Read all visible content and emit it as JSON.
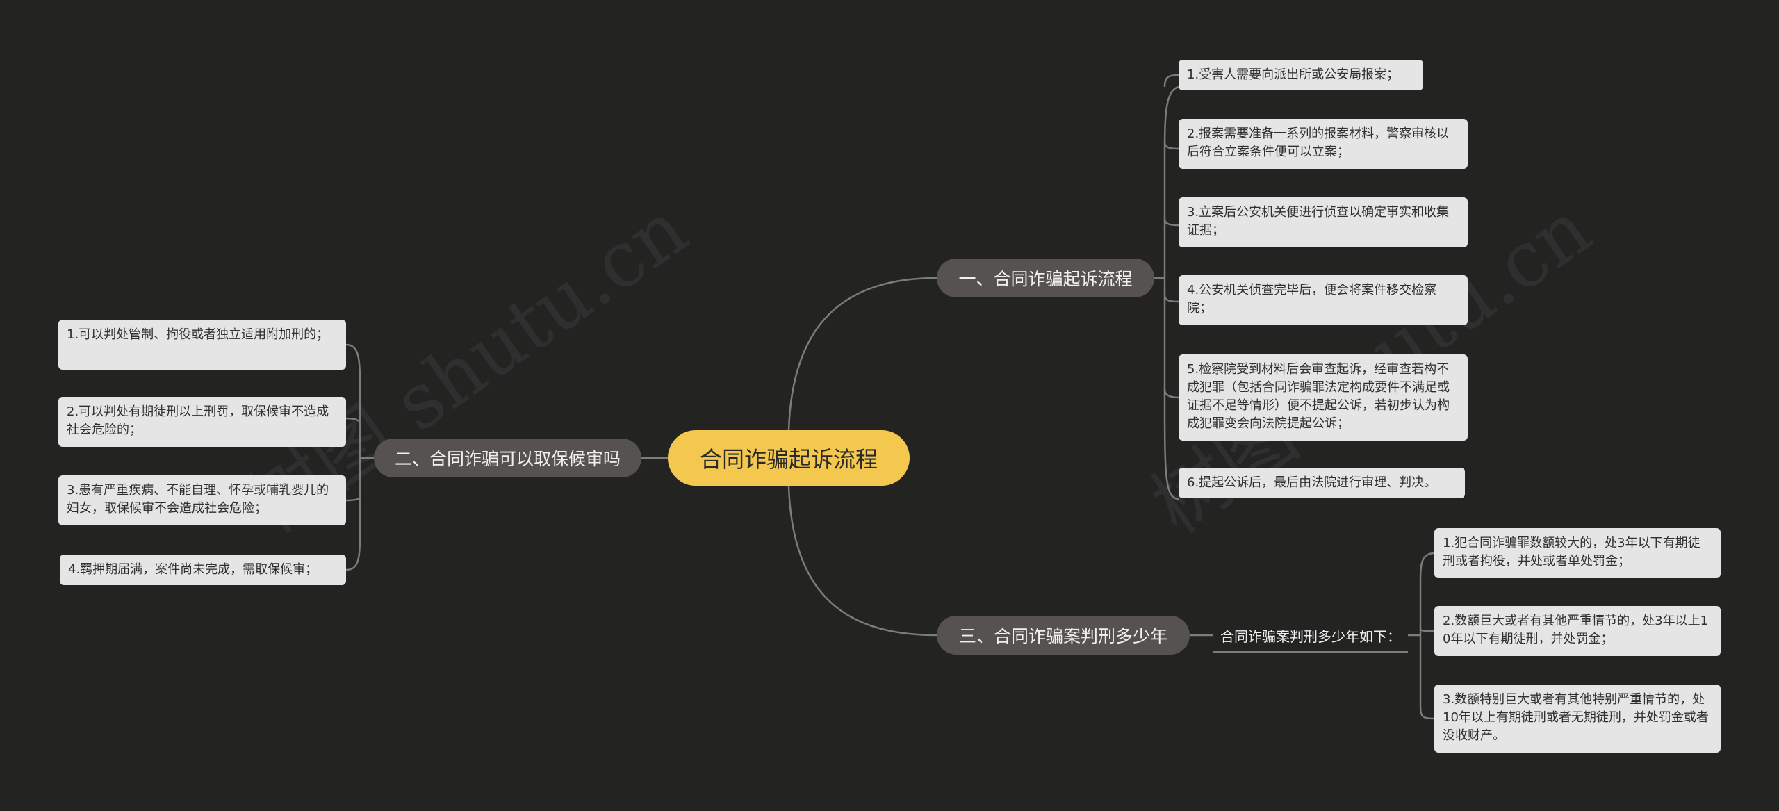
{
  "root": {
    "label": "合同诈骗起诉流程"
  },
  "watermark": "树图 shutu.cn",
  "branches": [
    {
      "label": "一、合同诈骗起诉流程",
      "items": [
        "1.受害人需要向派出所或公安局报案；",
        "2.报案需要准备一系列的报案材料，警察审核以后符合立案条件便可以立案；",
        "3.立案后公安机关便进行侦查以确定事实和收集证据；",
        "4.公安机关侦查完毕后，便会将案件移交检察院；",
        "5.检察院受到材料后会审查起诉，经审查若构不成犯罪（包括合同诈骗罪法定构成要件不满足或证据不足等情形）便不提起公诉，若初步认为构成犯罪变会向法院提起公诉；",
        "6.提起公诉后，最后由法院进行审理、判决。"
      ]
    },
    {
      "label": "二、合同诈骗可以取保候审吗",
      "items": [
        "1.可以判处管制、拘役或者独立适用附加刑的；",
        "2.可以判处有期徒刑以上刑罚，取保候审不造成社会危险的；",
        "3.患有严重疾病、不能自理、怀孕或哺乳婴儿的妇女，取保候审不会造成社会危险；",
        "4.羁押期届满，案件尚未完成，需取保候审；"
      ]
    },
    {
      "label": "三、合同诈骗案判刑多少年",
      "sub_label": "合同诈骗案判刑多少年如下：",
      "items": [
        "1.犯合同诈骗罪数额较大的，处3年以下有期徒刑或者拘役，并处或者单处罚金；",
        "2.数额巨大或者有其他严重情节的，处3年以上10年以下有期徒刑，并处罚金；",
        "3.数额特别巨大或者有其他特别严重情节的，处10年以上有期徒刑或者无期徒刑，并处罚金或者没收财产。"
      ]
    }
  ],
  "colors": {
    "background": "#232322",
    "root": "#f4c84e",
    "branch": "#56524f",
    "leaf": "#e5e5e5",
    "connector": "#7c7c7c"
  }
}
